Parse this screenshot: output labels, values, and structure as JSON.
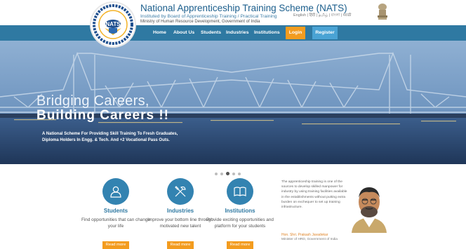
{
  "header": {
    "logo_text": "NATS",
    "title": "National Apprenticeship Training Scheme (NATS)",
    "subtitle": "Instituted by Board of Apprenticeship Training / Practical Training",
    "ministry": "Ministry of Human Resource Development, Government of India",
    "languages": "English | हिंदी | தமிழ் | বাংলা | मराठी"
  },
  "nav": {
    "items": [
      "Home",
      "About Us",
      "Students",
      "Industries",
      "Institutions"
    ],
    "login": "Login",
    "register": "Register"
  },
  "banner": {
    "line1": "Bridging Careers,",
    "line2": "Building Careers !!",
    "tagline1": "A National Scheme For Providing Skill Training To Fresh Graduates,",
    "tagline2": "Diploma Holders In Engg. & Tech. And +2 Vocational Pass Outs."
  },
  "slider": {
    "count": 5,
    "active": 3
  },
  "cards": [
    {
      "title": "Students",
      "desc": "Find opportunities that can change your life",
      "button": "Read more"
    },
    {
      "title": "Industries",
      "desc": "Improve your bottom line through motivated new talent",
      "button": "Read more"
    },
    {
      "title": "Institutions",
      "desc": "Provide exciting opportunities and platform for your students",
      "button": "Read more"
    }
  ],
  "quote": {
    "text": "The apprenticeship training is one of the sources to develop skilled manpower for industry by using training facilities available in the establishments without putting extra burden on exchequer to set up training infrastructure.",
    "name": "Hon. Shri. Prakash Javadekar",
    "role": "Minister of HRD, Government of India"
  },
  "colors": {
    "nav": "#2f79a2",
    "accent": "#f39c1f",
    "register": "#4aa3d4"
  }
}
